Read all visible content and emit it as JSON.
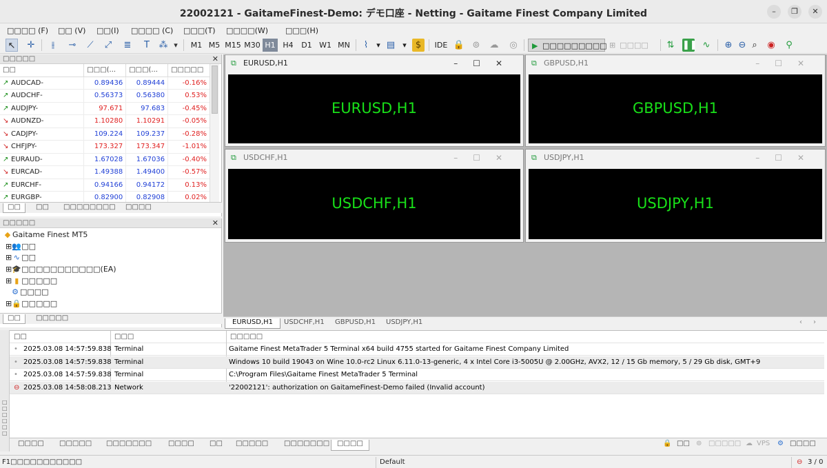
{
  "window": {
    "title": "22002121 - GaitameFinest-Demo: デモ口座 - Netting - Gaitame Finest Company Limited",
    "min": "–",
    "max": "❐",
    "close": "✕"
  },
  "menu": [
    "□□□□ (F)",
    "□□ (V)",
    "□□(I)",
    "□□□□ (C)",
    "□□□(T)",
    "□□□□(W)",
    "□□□(H)"
  ],
  "toolbar": {
    "timeframes": [
      "M1",
      "M5",
      "M15",
      "M30",
      "H1",
      "H4",
      "D1",
      "W1",
      "MN"
    ],
    "active_timeframe": "H1",
    "ide": "IDE",
    "algo_label": "□□□□□□□□□",
    "new_order": "□□□□"
  },
  "market_watch": {
    "header": "□□□□□",
    "columns": [
      "□□",
      "□□□(...",
      "□□□(...",
      "□□□□□"
    ],
    "rows": [
      {
        "symbol": "AUDCAD-",
        "dir": "up",
        "bid": "0.89436",
        "ask": "0.89444",
        "change": "-0.16%",
        "color": "blue"
      },
      {
        "symbol": "AUDCHF-",
        "dir": "up",
        "bid": "0.56373",
        "ask": "0.56380",
        "change": "0.53%",
        "color": "blue"
      },
      {
        "symbol": "AUDJPY-",
        "dir": "up",
        "bid": "97.671",
        "ask": "97.683",
        "change": "-0.45%",
        "color": "mixed"
      },
      {
        "symbol": "AUDNZD-",
        "dir": "dn",
        "bid": "1.10280",
        "ask": "1.10291",
        "change": "-0.05%",
        "color": "red"
      },
      {
        "symbol": "CADJPY-",
        "dir": "dn",
        "bid": "109.224",
        "ask": "109.237",
        "change": "-0.28%",
        "color": "blue"
      },
      {
        "symbol": "CHFJPY-",
        "dir": "dn",
        "bid": "173.327",
        "ask": "173.347",
        "change": "-1.01%",
        "color": "red"
      },
      {
        "symbol": "EURAUD-",
        "dir": "up",
        "bid": "1.67028",
        "ask": "1.67036",
        "change": "-0.40%",
        "color": "blue"
      },
      {
        "symbol": "EURCAD-",
        "dir": "dn",
        "bid": "1.49388",
        "ask": "1.49400",
        "change": "-0.57%",
        "color": "blue"
      },
      {
        "symbol": "EURCHF-",
        "dir": "up",
        "bid": "0.94166",
        "ask": "0.94172",
        "change": "0.13%",
        "color": "blue"
      },
      {
        "symbol": "EURGBP-",
        "dir": "up",
        "bid": "0.82900",
        "ask": "0.82908",
        "change": "0.02%",
        "color": "blue"
      }
    ],
    "tabs": [
      "□□",
      "□□",
      "□□□□□□□□",
      "□□□□"
    ]
  },
  "navigator": {
    "header": "□□□□□",
    "root": "Gaitame Finest MT5",
    "items": [
      "□□",
      "□□",
      "□□□□□□□□□□□(EA)",
      "□□□□□",
      "□□□□",
      "□□□□□"
    ],
    "tabs": [
      "□□",
      "□□□□□"
    ]
  },
  "charts": [
    {
      "title": "EURUSD,H1",
      "label": "EURUSD,H1",
      "active": true
    },
    {
      "title": "GBPUSD,H1",
      "label": "GBPUSD,H1",
      "active": false
    },
    {
      "title": "USDCHF,H1",
      "label": "USDCHF,H1",
      "active": false
    },
    {
      "title": "USDJPY,H1",
      "label": "USDJPY,H1",
      "active": false
    }
  ],
  "chart_tabs": [
    "EURUSD,H1",
    "USDCHF,H1",
    "GBPUSD,H1",
    "USDJPY,H1"
  ],
  "journal": {
    "columns": [
      "□□",
      "□□□",
      "□□□□□"
    ],
    "rows": [
      {
        "time": "2025.03.08 14:57:59.838",
        "source": "Terminal",
        "message": "Gaitame Finest MetaTrader 5 Terminal x64 build 4755 started for Gaitame Finest Company Limited",
        "error": false
      },
      {
        "time": "2025.03.08 14:57:59.838",
        "source": "Terminal",
        "message": "Windows 10 build 19043 on Wine 10.0-rc2 Linux 6.11.0-13-generic, 4 x Intel Core i3-5005U  @ 2.00GHz, AVX2, 12 / 15 Gb memory, 5 / 29 Gb disk, GMT+9",
        "error": false
      },
      {
        "time": "2025.03.08 14:57:59.838",
        "source": "Terminal",
        "message": "C:\\Program Files\\Gaitame Finest MetaTrader 5 Terminal",
        "error": false
      },
      {
        "time": "2025.03.08 14:58:08.213",
        "source": "Network",
        "message": "'22002121': authorization on GaitameFinest-Demo failed (Invalid account)",
        "error": true
      }
    ]
  },
  "bottom_tabs": [
    "□□□□",
    "□□□□□",
    "□□□□□□□",
    "□□□□",
    "□□",
    "□□□□□",
    "□□□□□□□",
    "□□□□"
  ],
  "bottom_right": {
    "safe": "□□",
    "signals": "□□□□□",
    "vps": "VPS",
    "tester": "□□□□"
  },
  "status": {
    "help": "F1□□□□□□□□□□□",
    "profile": "Default",
    "connection": "3 / 0"
  }
}
